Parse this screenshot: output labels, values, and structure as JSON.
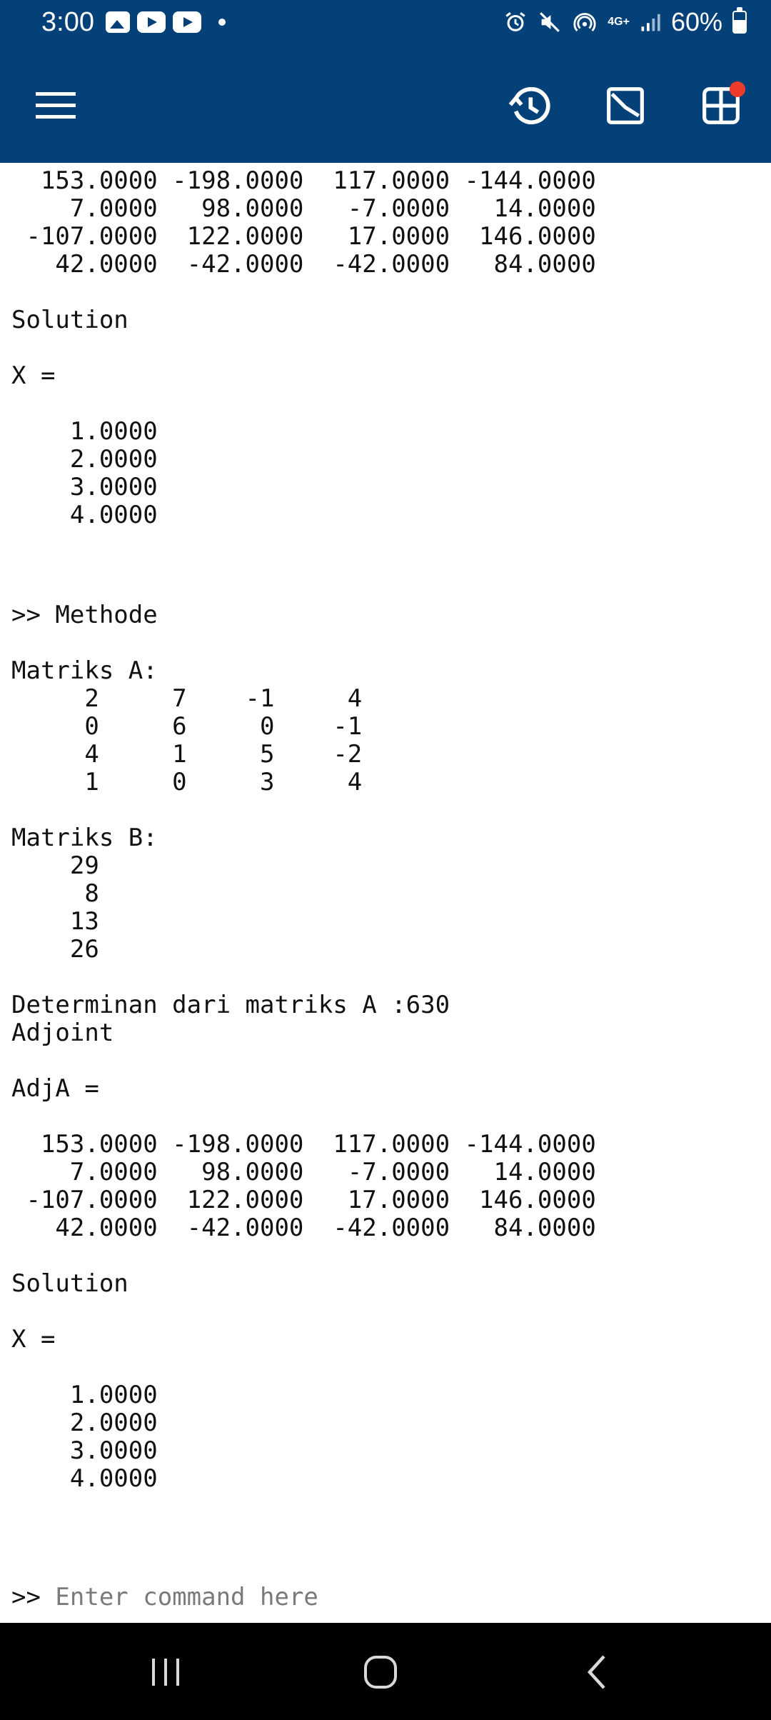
{
  "status_bar": {
    "time": "3:00",
    "left_icons": [
      "gallery-icon",
      "youtube-icon",
      "youtube-icon",
      "dot-icon"
    ],
    "right_icons": [
      "alarm-icon",
      "mute-icon",
      "hotspot-icon",
      "4g-icon",
      "signal-icon"
    ],
    "network": "4G+",
    "battery": "60%"
  },
  "app_bar": {
    "menu_icon": "hamburger-icon",
    "history_icon": "history-icon",
    "plot_icon": "plot-icon",
    "workspace_icon": "grid-icon",
    "notification_color": "#ef3b2c",
    "bar_color": "#044178"
  },
  "console": {
    "top_clip": "  153.0000 -198.0000  117.0000 -144.0000\n    7.0000   98.0000   -7.0000   14.0000\n -107.0000  122.0000   17.0000  146.0000\n   42.0000  -42.0000  -42.0000   84.0000\n\nSolution\n\nX =\n\n    1.0000\n    2.0000\n    3.0000\n    4.0000",
    "main_block": ">> Methode\n\nMatriks A:\n     2     7    -1     4\n     0     6     0    -1\n     4     1     5    -2\n     1     0     3     4\n\nMatriks B:\n    29\n     8\n    13\n    26\n\nDeterminan dari matriks A :630\nAdjoint\n\nAdjA =\n\n  153.0000 -198.0000  117.0000 -144.0000\n    7.0000   98.0000   -7.0000   14.0000\n -107.0000  122.0000   17.0000  146.0000\n   42.0000  -42.0000  -42.0000   84.0000\n\nSolution\n\nX =\n\n    1.0000\n    2.0000\n    3.0000\n    4.0000"
  },
  "command": {
    "prompt": ">> ",
    "placeholder": "Enter command here",
    "value": ""
  },
  "nav_bar": {
    "recents_icon": "recents-icon",
    "home_icon": "home-icon",
    "back_icon": "back-icon"
  }
}
